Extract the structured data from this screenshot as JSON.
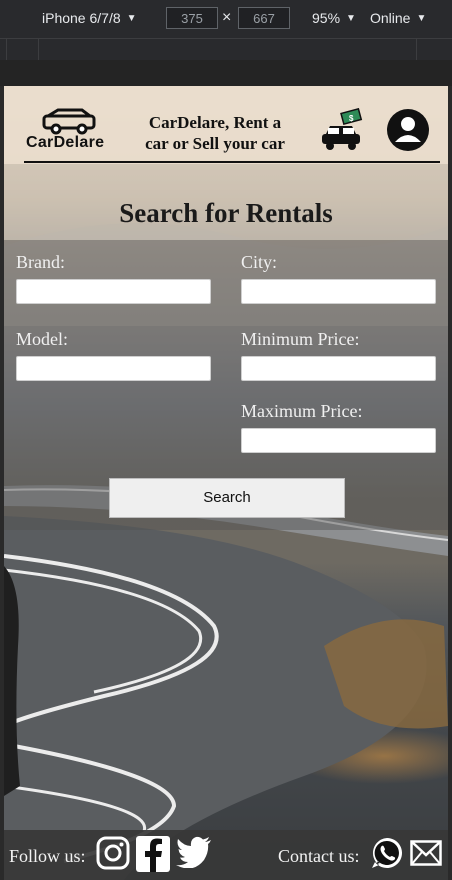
{
  "devtools": {
    "device": "iPhone 6/7/8",
    "width": "375",
    "height": "667",
    "times": "×",
    "zoom": "95%",
    "network": "Online"
  },
  "header": {
    "logo_text": "CarDelare",
    "tagline_line1": "CarDelare, Rent a",
    "tagline_line2": "car or Sell your car",
    "sell_badge": "$"
  },
  "search": {
    "title": "Search for Rentals",
    "brand_label": "Brand:",
    "city_label": "City:",
    "model_label": "Model:",
    "min_price_label": "Minimum Price:",
    "max_price_label": "Maximum Price:",
    "button_label": "Search",
    "brand_value": "",
    "city_value": "",
    "model_value": "",
    "min_price_value": "",
    "max_price_value": ""
  },
  "footer": {
    "follow_label": "Follow us:",
    "contact_label": "Contact us:"
  },
  "icons": [
    "car-icon",
    "car-dollar-icon",
    "account-icon",
    "instagram-icon",
    "facebook-icon",
    "twitter-icon",
    "whatsapp-icon",
    "mail-icon"
  ]
}
